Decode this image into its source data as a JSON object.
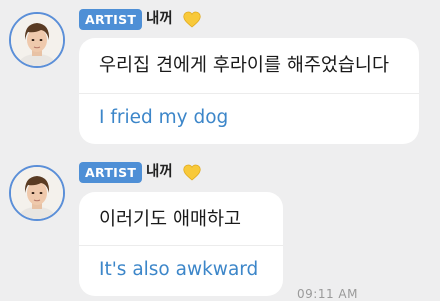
{
  "messages": [
    {
      "badge": "ARTIST",
      "sender": "내꺼",
      "original_text": "우리집 견에게 후라이를 해주었습니다",
      "translation": "I fried my dog",
      "avatar_icon": "profile-photo",
      "heart_icon": "yellow-heart"
    },
    {
      "badge": "ARTIST",
      "sender": "내꺼",
      "original_text": "이러기도 애매하고",
      "translation": "It's also awkward",
      "avatar_icon": "profile-photo",
      "heart_icon": "yellow-heart"
    }
  ],
  "timestamp": "09:11 AM",
  "colors": {
    "badge": "#4e8fd6",
    "translation": "#3c86c9",
    "background": "#eeeeef",
    "bubble": "#ffffff",
    "heart": "#f8c93a"
  }
}
